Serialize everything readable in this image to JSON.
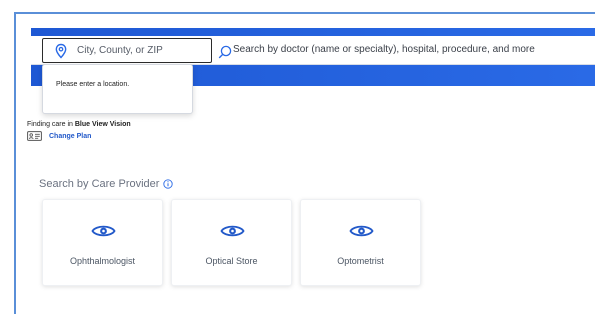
{
  "search": {
    "location_placeholder": "City, County, or ZIP",
    "query_placeholder": "Search by doctor (name or specialty), hospital, procedure, and more"
  },
  "tooltip": {
    "message": "Please enter a location."
  },
  "plan": {
    "finding_prefix": "Finding care in ",
    "plan_name": "Blue View Vision",
    "change_plan_label": "Change Plan"
  },
  "providers": {
    "title": "Search by Care Provider",
    "items": [
      {
        "label": "Ophthalmologist",
        "icon": "eye-icon"
      },
      {
        "label": "Optical Store",
        "icon": "eye-icon"
      },
      {
        "label": "Optometrist",
        "icon": "eye-icon"
      }
    ]
  },
  "colors": {
    "brand_blue": "#2a6ae6",
    "link_blue": "#2259c9"
  }
}
